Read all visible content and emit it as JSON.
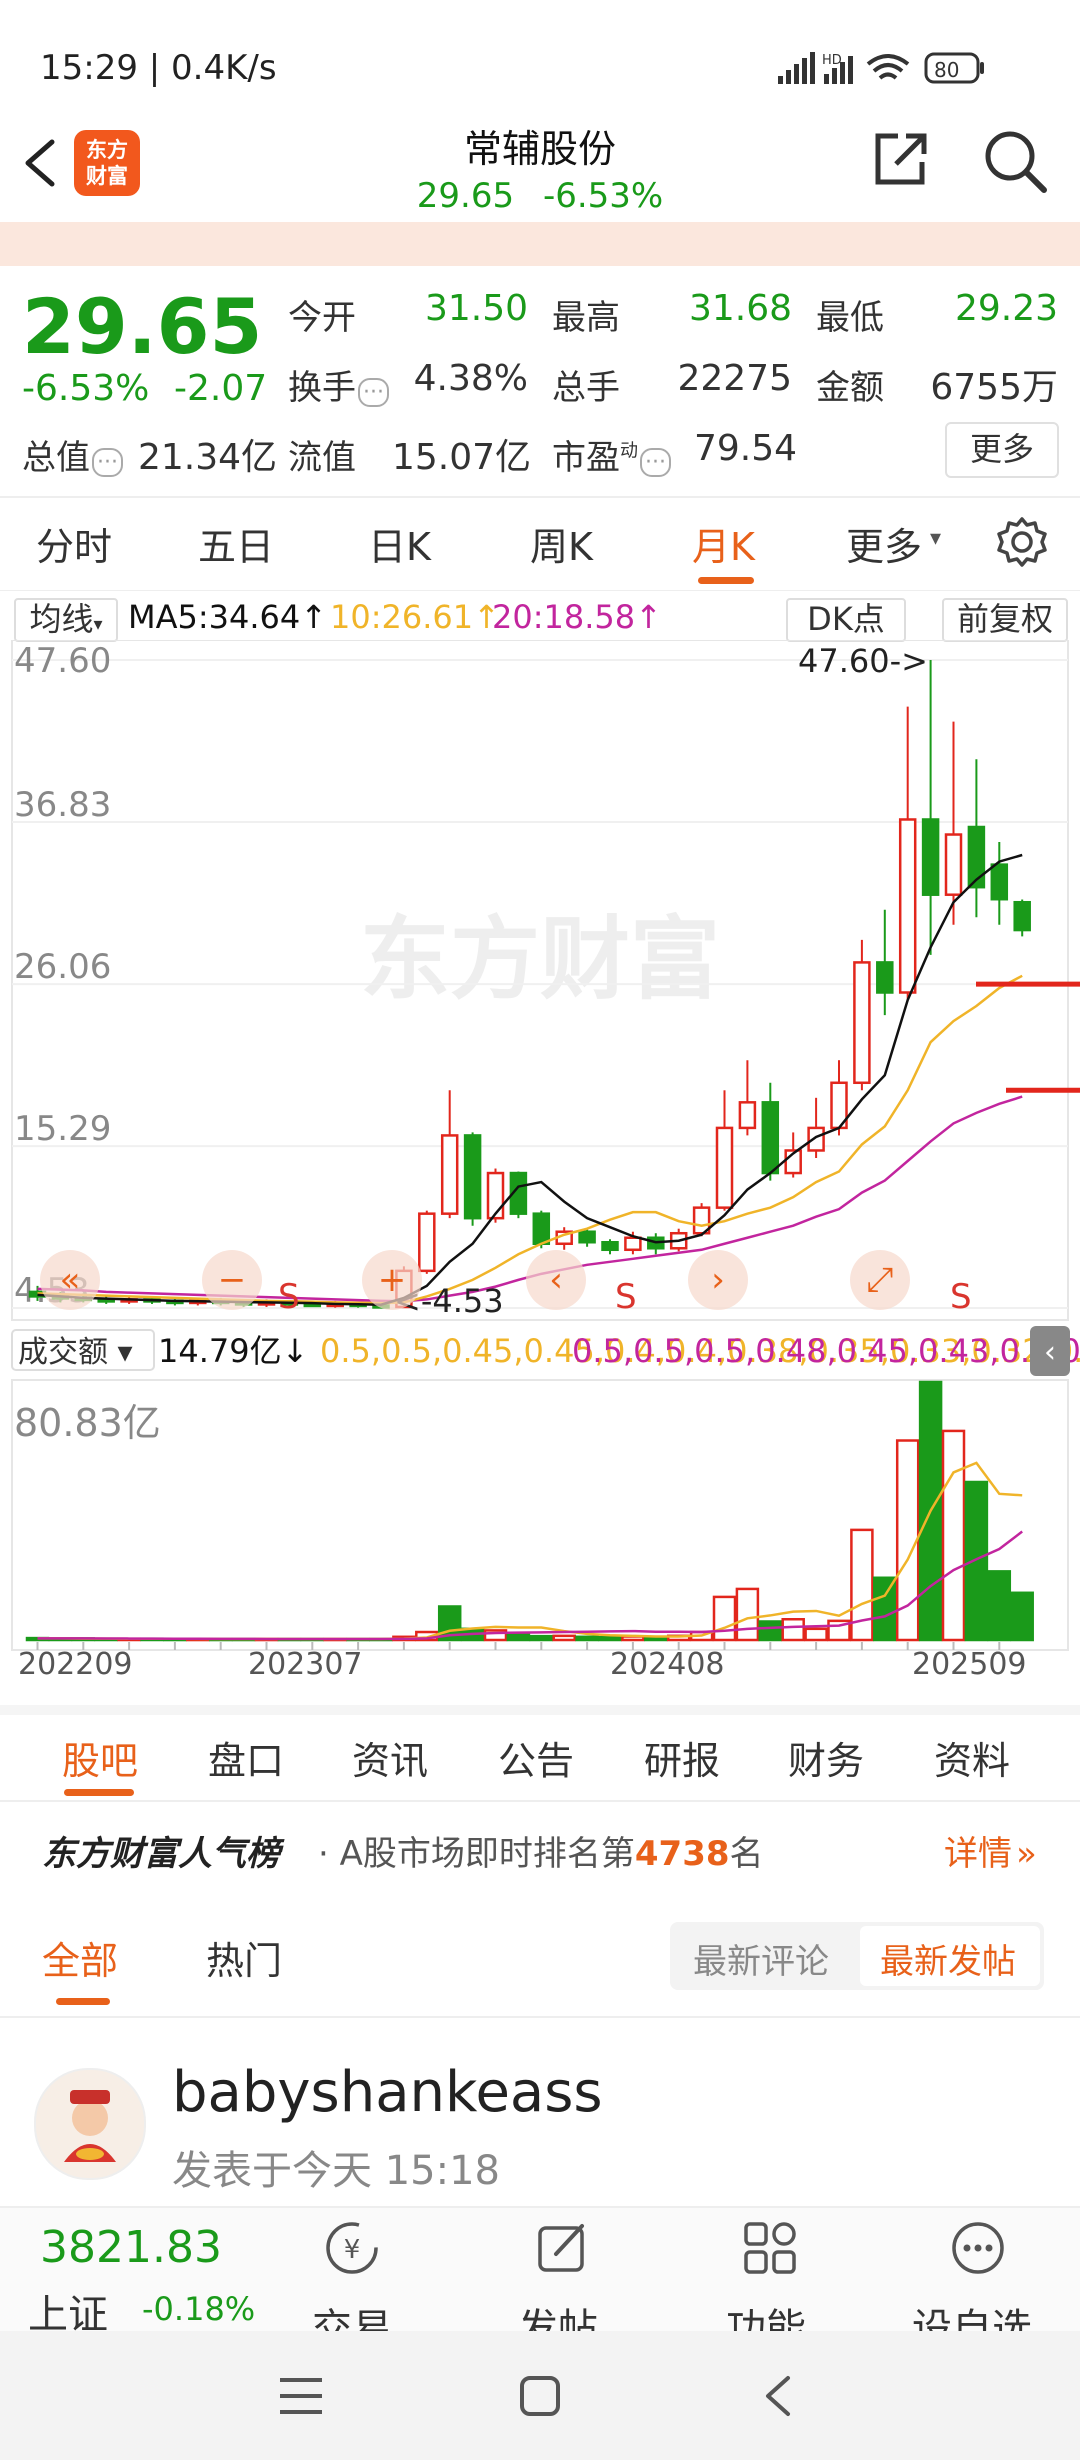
{
  "status": {
    "time_rate": "15:29 | 0.4K/s",
    "battery": "80"
  },
  "header": {
    "stock_name": "常辅股份",
    "price": "29.65",
    "change_pct": "-6.53%",
    "logo_text_1": "东方",
    "logo_text_2": "财富"
  },
  "quote": {
    "price": "29.65",
    "change_pct": "-6.53%",
    "change_amt": "-2.07",
    "fields": {
      "open_label": "今开",
      "open": "31.50",
      "high_label": "最高",
      "high": "31.68",
      "low_label": "最低",
      "low": "29.23",
      "turnover_label": "换手",
      "turnover": "4.38%",
      "volume_label": "总手",
      "volume": "22275",
      "amount_label": "金额",
      "amount": "6755万",
      "mktcap_label": "总值",
      "mktcap": "21.34亿",
      "float_label": "流值",
      "float": "15.07亿",
      "pe_label": "市盈",
      "pe_sup": "动",
      "pe": "79.54"
    },
    "more_label": "更多"
  },
  "kline_tabs": [
    {
      "label": "分时",
      "active": false
    },
    {
      "label": "五日",
      "active": false
    },
    {
      "label": "日K",
      "active": false
    },
    {
      "label": "周K",
      "active": false
    },
    {
      "label": "月K",
      "active": true
    },
    {
      "label": "更多",
      "active": false
    }
  ],
  "ma_row": {
    "type_label": "均线",
    "ma5": "MA5:34.64↑",
    "ma10": "10:26.61↑",
    "ma20": "20:18.58↑",
    "dk_label": "DK点",
    "adjust_label": "前复权"
  },
  "colors": {
    "up": "#e2261c",
    "down": "#1a9a1a",
    "ma5": "#111111",
    "ma10": "#f0b429",
    "ma20": "#c2259e",
    "accent": "#e8611a"
  },
  "chart_data": {
    "type": "candlestick",
    "watermark": "东方财富",
    "y_ticks": [
      "47.60",
      "36.83",
      "26.06",
      "15.29",
      "4.53"
    ],
    "ylim": [
      4.53,
      47.6
    ],
    "max_annotation": "47.60->",
    "min_annotation": "<-4.53",
    "x_ticks": [
      "202209",
      "202307",
      "202408",
      "202509"
    ],
    "sell_marks": [
      "S",
      "S",
      "S"
    ],
    "candles": [
      {
        "o": 5.6,
        "c": 5.3,
        "h": 6.0,
        "l": 5.0
      },
      {
        "o": 5.3,
        "c": 5.2,
        "h": 5.6,
        "l": 4.9
      },
      {
        "o": 5.2,
        "c": 5.1,
        "h": 5.5,
        "l": 4.9
      },
      {
        "o": 5.1,
        "c": 5.0,
        "h": 5.4,
        "l": 4.8
      },
      {
        "o": 5.0,
        "c": 5.1,
        "h": 5.3,
        "l": 4.8
      },
      {
        "o": 5.1,
        "c": 5.0,
        "h": 5.3,
        "l": 4.8
      },
      {
        "o": 5.0,
        "c": 4.9,
        "h": 5.2,
        "l": 4.7
      },
      {
        "o": 4.9,
        "c": 5.0,
        "h": 5.2,
        "l": 4.7
      },
      {
        "o": 5.0,
        "c": 4.9,
        "h": 5.2,
        "l": 4.7
      },
      {
        "o": 4.9,
        "c": 4.8,
        "h": 5.1,
        "l": 4.6
      },
      {
        "o": 4.8,
        "c": 4.9,
        "h": 5.1,
        "l": 4.6
      },
      {
        "o": 4.9,
        "c": 4.8,
        "h": 5.0,
        "l": 4.6
      },
      {
        "o": 4.8,
        "c": 4.7,
        "h": 5.0,
        "l": 4.6
      },
      {
        "o": 4.7,
        "c": 4.8,
        "h": 5.0,
        "l": 4.55
      },
      {
        "o": 4.8,
        "c": 4.7,
        "h": 4.95,
        "l": 4.55
      },
      {
        "o": 4.7,
        "c": 4.6,
        "h": 4.9,
        "l": 4.53
      },
      {
        "o": 4.6,
        "c": 7.0,
        "h": 7.3,
        "l": 4.53
      },
      {
        "o": 7.0,
        "c": 10.8,
        "h": 11.0,
        "l": 6.8
      },
      {
        "o": 10.8,
        "c": 16.0,
        "h": 19.0,
        "l": 10.5
      },
      {
        "o": 16.0,
        "c": 10.5,
        "h": 16.2,
        "l": 10.0
      },
      {
        "o": 10.5,
        "c": 13.5,
        "h": 13.8,
        "l": 10.2
      },
      {
        "o": 13.5,
        "c": 10.8,
        "h": 13.6,
        "l": 10.5
      },
      {
        "o": 10.8,
        "c": 8.8,
        "h": 11.0,
        "l": 8.5
      },
      {
        "o": 8.8,
        "c": 9.6,
        "h": 9.9,
        "l": 8.4
      },
      {
        "o": 9.6,
        "c": 8.9,
        "h": 9.8,
        "l": 8.6
      },
      {
        "o": 8.9,
        "c": 8.4,
        "h": 9.1,
        "l": 8.1
      },
      {
        "o": 8.4,
        "c": 9.2,
        "h": 9.6,
        "l": 8.1
      },
      {
        "o": 9.2,
        "c": 8.5,
        "h": 9.5,
        "l": 8.1
      },
      {
        "o": 8.5,
        "c": 9.5,
        "h": 9.8,
        "l": 8.3
      },
      {
        "o": 9.5,
        "c": 11.2,
        "h": 11.5,
        "l": 9.3
      },
      {
        "o": 11.2,
        "c": 16.5,
        "h": 19.0,
        "l": 11.0
      },
      {
        "o": 16.5,
        "c": 18.2,
        "h": 21.0,
        "l": 16.0
      },
      {
        "o": 18.2,
        "c": 13.5,
        "h": 19.5,
        "l": 13.0
      },
      {
        "o": 13.5,
        "c": 15.0,
        "h": 16.2,
        "l": 13.2
      },
      {
        "o": 15.0,
        "c": 16.5,
        "h": 18.5,
        "l": 14.5
      },
      {
        "o": 16.5,
        "c": 19.5,
        "h": 21.0,
        "l": 16.0
      },
      {
        "o": 19.5,
        "c": 27.5,
        "h": 29.0,
        "l": 19.0
      },
      {
        "o": 27.5,
        "c": 25.5,
        "h": 31.0,
        "l": 24.0
      },
      {
        "o": 25.5,
        "c": 37.0,
        "h": 44.5,
        "l": 25.0
      },
      {
        "o": 37.0,
        "c": 32.0,
        "h": 47.6,
        "l": 28.0
      },
      {
        "o": 32.0,
        "c": 36.0,
        "h": 43.5,
        "l": 30.0
      },
      {
        "o": 36.5,
        "c": 32.5,
        "h": 41.0,
        "l": 30.5
      },
      {
        "o": 34.0,
        "c": 31.7,
        "h": 35.5,
        "l": 30.0
      },
      {
        "o": 31.5,
        "c": 29.65,
        "h": 31.68,
        "l": 29.23
      }
    ],
    "ma5": [
      5.4,
      5.3,
      5.2,
      5.15,
      5.1,
      5.05,
      5.0,
      4.98,
      4.95,
      4.92,
      4.9,
      4.88,
      4.85,
      4.8,
      4.78,
      4.75,
      5.2,
      6.0,
      7.6,
      8.8,
      10.8,
      12.6,
      12.9,
      11.6,
      10.5,
      9.9,
      9.3,
      8.9,
      9.0,
      9.4,
      10.7,
      12.4,
      13.5,
      14.8,
      15.9,
      16.5,
      18.4,
      20.0,
      25.0,
      28.5,
      31.5,
      33.0,
      34.2,
      34.64
    ],
    "ma10": [
      5.5,
      5.45,
      5.4,
      5.35,
      5.3,
      5.25,
      5.2,
      5.15,
      5.1,
      5.05,
      5.0,
      4.98,
      4.95,
      4.9,
      4.88,
      4.85,
      4.9,
      5.3,
      5.8,
      6.4,
      7.2,
      8.1,
      8.8,
      9.4,
      9.8,
      10.4,
      10.9,
      10.9,
      10.3,
      10.0,
      10.3,
      10.8,
      11.2,
      11.9,
      12.9,
      13.6,
      15.4,
      16.6,
      19.0,
      22.2,
      23.6,
      24.6,
      25.8,
      26.61
    ],
    "ma20": [
      5.8,
      5.75,
      5.7,
      5.6,
      5.55,
      5.5,
      5.45,
      5.4,
      5.35,
      5.3,
      5.25,
      5.2,
      5.15,
      5.1,
      5.05,
      5.0,
      4.98,
      5.1,
      5.35,
      5.6,
      5.95,
      6.4,
      6.8,
      7.1,
      7.4,
      7.6,
      7.8,
      8.0,
      8.2,
      8.4,
      8.8,
      9.2,
      9.6,
      10.0,
      10.6,
      11.1,
      12.2,
      13.0,
      14.3,
      15.6,
      16.8,
      17.5,
      18.1,
      18.58
    ],
    "hold_line_1": 26.06,
    "hold_line_2": 19.0
  },
  "volume_panel": {
    "type_label": "成交额",
    "value": "14.79亿↓",
    "ma1": [
      0.5,
      0.5,
      0.45,
      0.45,
      0.4,
      0.4,
      0.38,
      0.35,
      0.33,
      0.32,
      0.3,
      0.3,
      0.3,
      0.3,
      0.3,
      0.3,
      0.44,
      0.8,
      2.9,
      3.6,
      4.1,
      3.9,
      3.9,
      2.8,
      1.9,
      1.5,
      1.3,
      1.1,
      1.1,
      1.4,
      3.8,
      6.8,
      7.7,
      8.9,
      9.1,
      7.6,
      11.3,
      13.9,
      25.2,
      40.5,
      52.5,
      55.5,
      45.8,
      45.33
    ],
    "ma2": [
      0.5,
      0.5,
      0.5,
      0.48,
      0.45,
      0.43,
      0.4,
      0.38,
      0.36,
      0.34,
      0.33,
      0.32,
      0.31,
      0.3,
      0.3,
      0.3,
      0.35,
      0.5,
      1.5,
      1.9,
      2.2,
      2.3,
      2.4,
      2.5,
      2.6,
      2.7,
      2.8,
      2.6,
      2.6,
      2.5,
      2.9,
      3.5,
      3.8,
      4.1,
      4.3,
      4.5,
      6.1,
      7.4,
      10.8,
      16.9,
      21.9,
      25.3,
      28.5,
      33.98
    ],
    "max_label": "80.83亿",
    "ylim": [
      0,
      80.83
    ],
    "values": [
      0.6,
      0.5,
      0.5,
      0.4,
      0.4,
      0.4,
      0.3,
      0.3,
      0.3,
      0.3,
      0.3,
      0.3,
      0.3,
      0.3,
      0.3,
      0.3,
      1.0,
      2.5,
      10.5,
      3.5,
      3.0,
      2.0,
      1.2,
      1.3,
      1.0,
      0.9,
      1.1,
      1.0,
      1.3,
      2.5,
      13.5,
      16.0,
      5.8,
      6.5,
      3.5,
      6.0,
      34.5,
      19.5,
      62.5,
      80.83,
      65.5,
      49.5,
      21.5,
      14.79
    ],
    "up": [
      false,
      false,
      false,
      false,
      true,
      false,
      false,
      true,
      false,
      false,
      true,
      false,
      false,
      true,
      false,
      false,
      true,
      true,
      false,
      false,
      true,
      false,
      false,
      true,
      false,
      false,
      true,
      false,
      true,
      true,
      true,
      true,
      false,
      true,
      true,
      true,
      true,
      false,
      true,
      false,
      true,
      false,
      false,
      false
    ]
  },
  "sub_tabs": [
    {
      "label": "股吧",
      "active": true
    },
    {
      "label": "盘口",
      "active": false
    },
    {
      "label": "资讯",
      "active": false
    },
    {
      "label": "公告",
      "active": false
    },
    {
      "label": "研报",
      "active": false
    },
    {
      "label": "财务",
      "active": false
    },
    {
      "label": "资料",
      "active": false
    }
  ],
  "rank": {
    "brand": "东方财富人气榜",
    "prefix": "· A股市场即时排名第",
    "number": "4738",
    "suffix": "名",
    "detail": "详情"
  },
  "post_tabs": {
    "all": "全部",
    "hot": "热门",
    "sort_comment": "最新评论",
    "sort_post": "最新发帖"
  },
  "post": {
    "author": "babyshankeass",
    "time": "发表于今天 15:18"
  },
  "bottom": {
    "index_value": "3821.83",
    "index_name": "上证",
    "index_change": "-0.18%",
    "items": [
      "交易",
      "发帖",
      "功能",
      "设自选"
    ]
  }
}
